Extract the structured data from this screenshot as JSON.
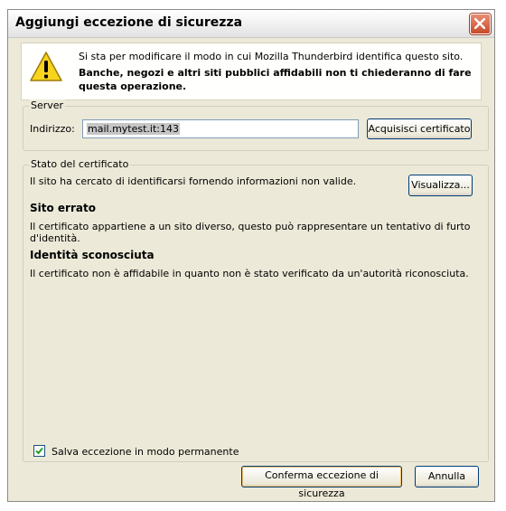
{
  "window": {
    "title": "Aggiungi eccezione di sicurezza"
  },
  "warning": {
    "icon": "warning-triangle-icon",
    "line1": "Si sta per modificare il modo in cui Mozilla Thunderbird identifica questo sito.",
    "line2": "Banche, negozi e altri siti pubblici affidabili non ti chiederanno di fare questa operazione."
  },
  "server": {
    "legend": "Server",
    "address_label": "Indirizzo:",
    "address_value": "mail.mytest.it:143",
    "acquire_button": "Acquisisci certificato"
  },
  "certificate": {
    "legend": "Stato del certificato",
    "status_text": "Il sito ha cercato di identificarsi fornendo informazioni non valide.",
    "view_button": "Visualizza...",
    "wrong_site_heading": "Sito errato",
    "wrong_site_text": "Il certificato appartiene a un sito diverso, questo può rappresentare un tentativo di furto d'identità.",
    "unknown_identity_heading": "Identità sconosciuta",
    "unknown_identity_text": "Il certificato non è affidabile in quanto non è stato verificato da un'autorità riconosciuta.",
    "save_permanent_label": "Salva eccezione in modo permanente",
    "save_permanent_checked": true
  },
  "footer": {
    "confirm_button": "Conferma eccezione di sicurezza",
    "cancel_button": "Annulla"
  }
}
